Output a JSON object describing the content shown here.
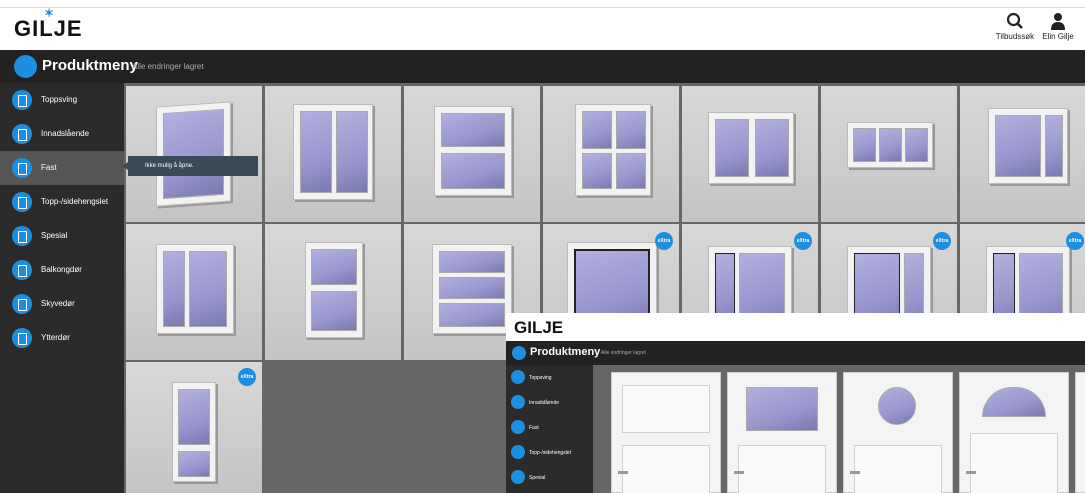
{
  "header": {
    "logo": "GILJE",
    "search_label": "Tilbudssøk",
    "user_label": "Elin Gilje"
  },
  "titlebar": {
    "title": "Produktmeny",
    "status": "Alle endringer lagret"
  },
  "sidebar": {
    "items": [
      {
        "label": "Toppsving"
      },
      {
        "label": "Innadslående"
      },
      {
        "label": "Fast"
      },
      {
        "label": "Topp-/sidehengslet"
      },
      {
        "label": "Spesial"
      },
      {
        "label": "Balkongdør"
      },
      {
        "label": "Skyvedør"
      },
      {
        "label": "Ytterdør"
      }
    ],
    "active_index": 2
  },
  "tooltip": "Ikke mulig å åpne.",
  "extra_badge": "eXtra",
  "overlay": {
    "logo": "GILJE",
    "title": "Produktmeny",
    "status": "Alle endringer lagret",
    "sidebar_items": [
      {
        "label": "Toppsving"
      },
      {
        "label": "Innadslående"
      },
      {
        "label": "Fast"
      },
      {
        "label": "Topp-/sidehengslet"
      },
      {
        "label": "Spesial"
      }
    ]
  },
  "colors": {
    "accent": "#1d8fe0",
    "dark": "#222222",
    "sidebar": "#2b2b2b"
  }
}
